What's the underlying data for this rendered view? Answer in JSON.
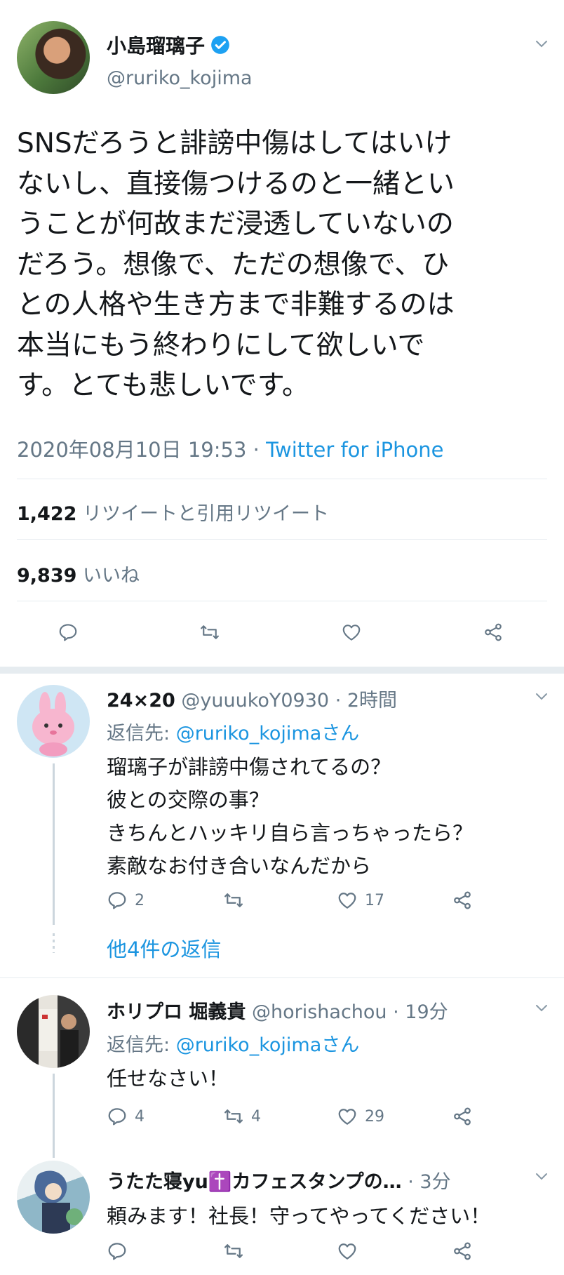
{
  "main_tweet": {
    "display_name": "小島瑠璃子",
    "handle": "@ruriko_kojima",
    "text_lines": [
      "SNSだろうと誹謗中傷はしてはいけ",
      "ないし、直接傷つけるのと一緒とい",
      "うことが何故まだ浸透していないの",
      "だろう。想像で、ただの想像で、ひ",
      "との人格や生き方まで非難するのは",
      "本当にもう終わりにして欲しいで",
      "す。とても悲しいです。"
    ],
    "timestamp": "2020年08月10日 19:53",
    "separator": " · ",
    "source": "Twitter for iPhone",
    "retweet_count": "1,422",
    "retweet_label": "リツイートと引用リツイート",
    "like_count": "9,839",
    "like_label": "いいね"
  },
  "replies": [
    {
      "display_name": "24×20",
      "handle": "@yuuukoY0930",
      "time": "· 2時間",
      "reply_prefix": "返信先: ",
      "reply_to": "@ruriko_kojimaさん",
      "text_lines": [
        "瑠璃子が誹謗中傷されてるの？",
        "彼との交際の事？",
        "きちんとハッキリ自ら言っちゃったら？",
        "素敵なお付き合いなんだから"
      ],
      "reply_count": "2",
      "retweet_count": "",
      "like_count": "17",
      "more_replies": "他4件の返信"
    },
    {
      "display_name": "ホリプロ 堀義貴",
      "handle": "@horishachou",
      "time": "· 19分",
      "reply_prefix": "返信先: ",
      "reply_to": "@ruriko_kojimaさん",
      "text_lines": [
        "任せなさい！"
      ],
      "reply_count": "4",
      "retweet_count": "4",
      "like_count": "29"
    },
    {
      "display_name": "うたた寝yu✝️カフェスタンプの…",
      "handle": "",
      "time": "· 3分",
      "text_lines": [
        "頼みます！社長！守ってやってください！"
      ],
      "reply_count": "",
      "retweet_count": "",
      "like_count": ""
    }
  ],
  "colors": {
    "accent": "#1b95e0",
    "secondary_text": "#657786",
    "divider": "#e6ecf0",
    "verified": "#1da1f2"
  },
  "icons": [
    "verified-badge-icon",
    "chevron-down-icon",
    "reply-icon",
    "retweet-icon",
    "like-icon",
    "share-icon"
  ]
}
